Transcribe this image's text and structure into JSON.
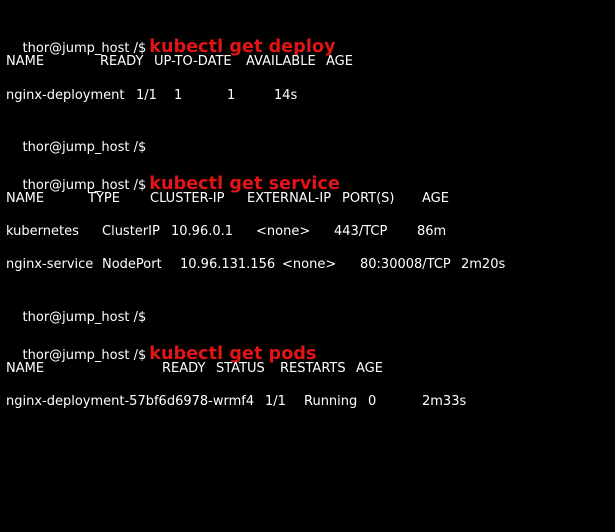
{
  "prompt": "thor@jump_host /$",
  "commands": {
    "deploy": "kubectl get deploy",
    "service": "kubectl get service",
    "pods": "kubectl get pods"
  },
  "deploy": {
    "headers": [
      "NAME",
      "READY",
      "UP-TO-DATE",
      "AVAILABLE",
      "AGE"
    ],
    "rows": [
      [
        "nginx-deployment",
        "1/1",
        "1",
        "1",
        "14s"
      ]
    ]
  },
  "service": {
    "headers": [
      "NAME",
      "TYPE",
      "CLUSTER-IP",
      "EXTERNAL-IP",
      "PORT(S)",
      "AGE"
    ],
    "rows": [
      [
        "kubernetes",
        "ClusterIP",
        "10.96.0.1",
        "<none>",
        "443/TCP",
        "86m"
      ],
      [
        "nginx-service",
        "NodePort",
        "10.96.131.156",
        "<none>",
        "80:30008/TCP",
        "2m20s"
      ]
    ]
  },
  "pods": {
    "headers": [
      "NAME",
      "READY",
      "STATUS",
      "RESTARTS",
      "AGE"
    ],
    "rows": [
      [
        "nginx-deployment-57bf6d6978-wrmf4",
        "1/1",
        "Running",
        "0",
        "2m33s"
      ]
    ]
  },
  "colors": {
    "background": "#000000",
    "text": "#ffffff",
    "command": "#e51414"
  }
}
